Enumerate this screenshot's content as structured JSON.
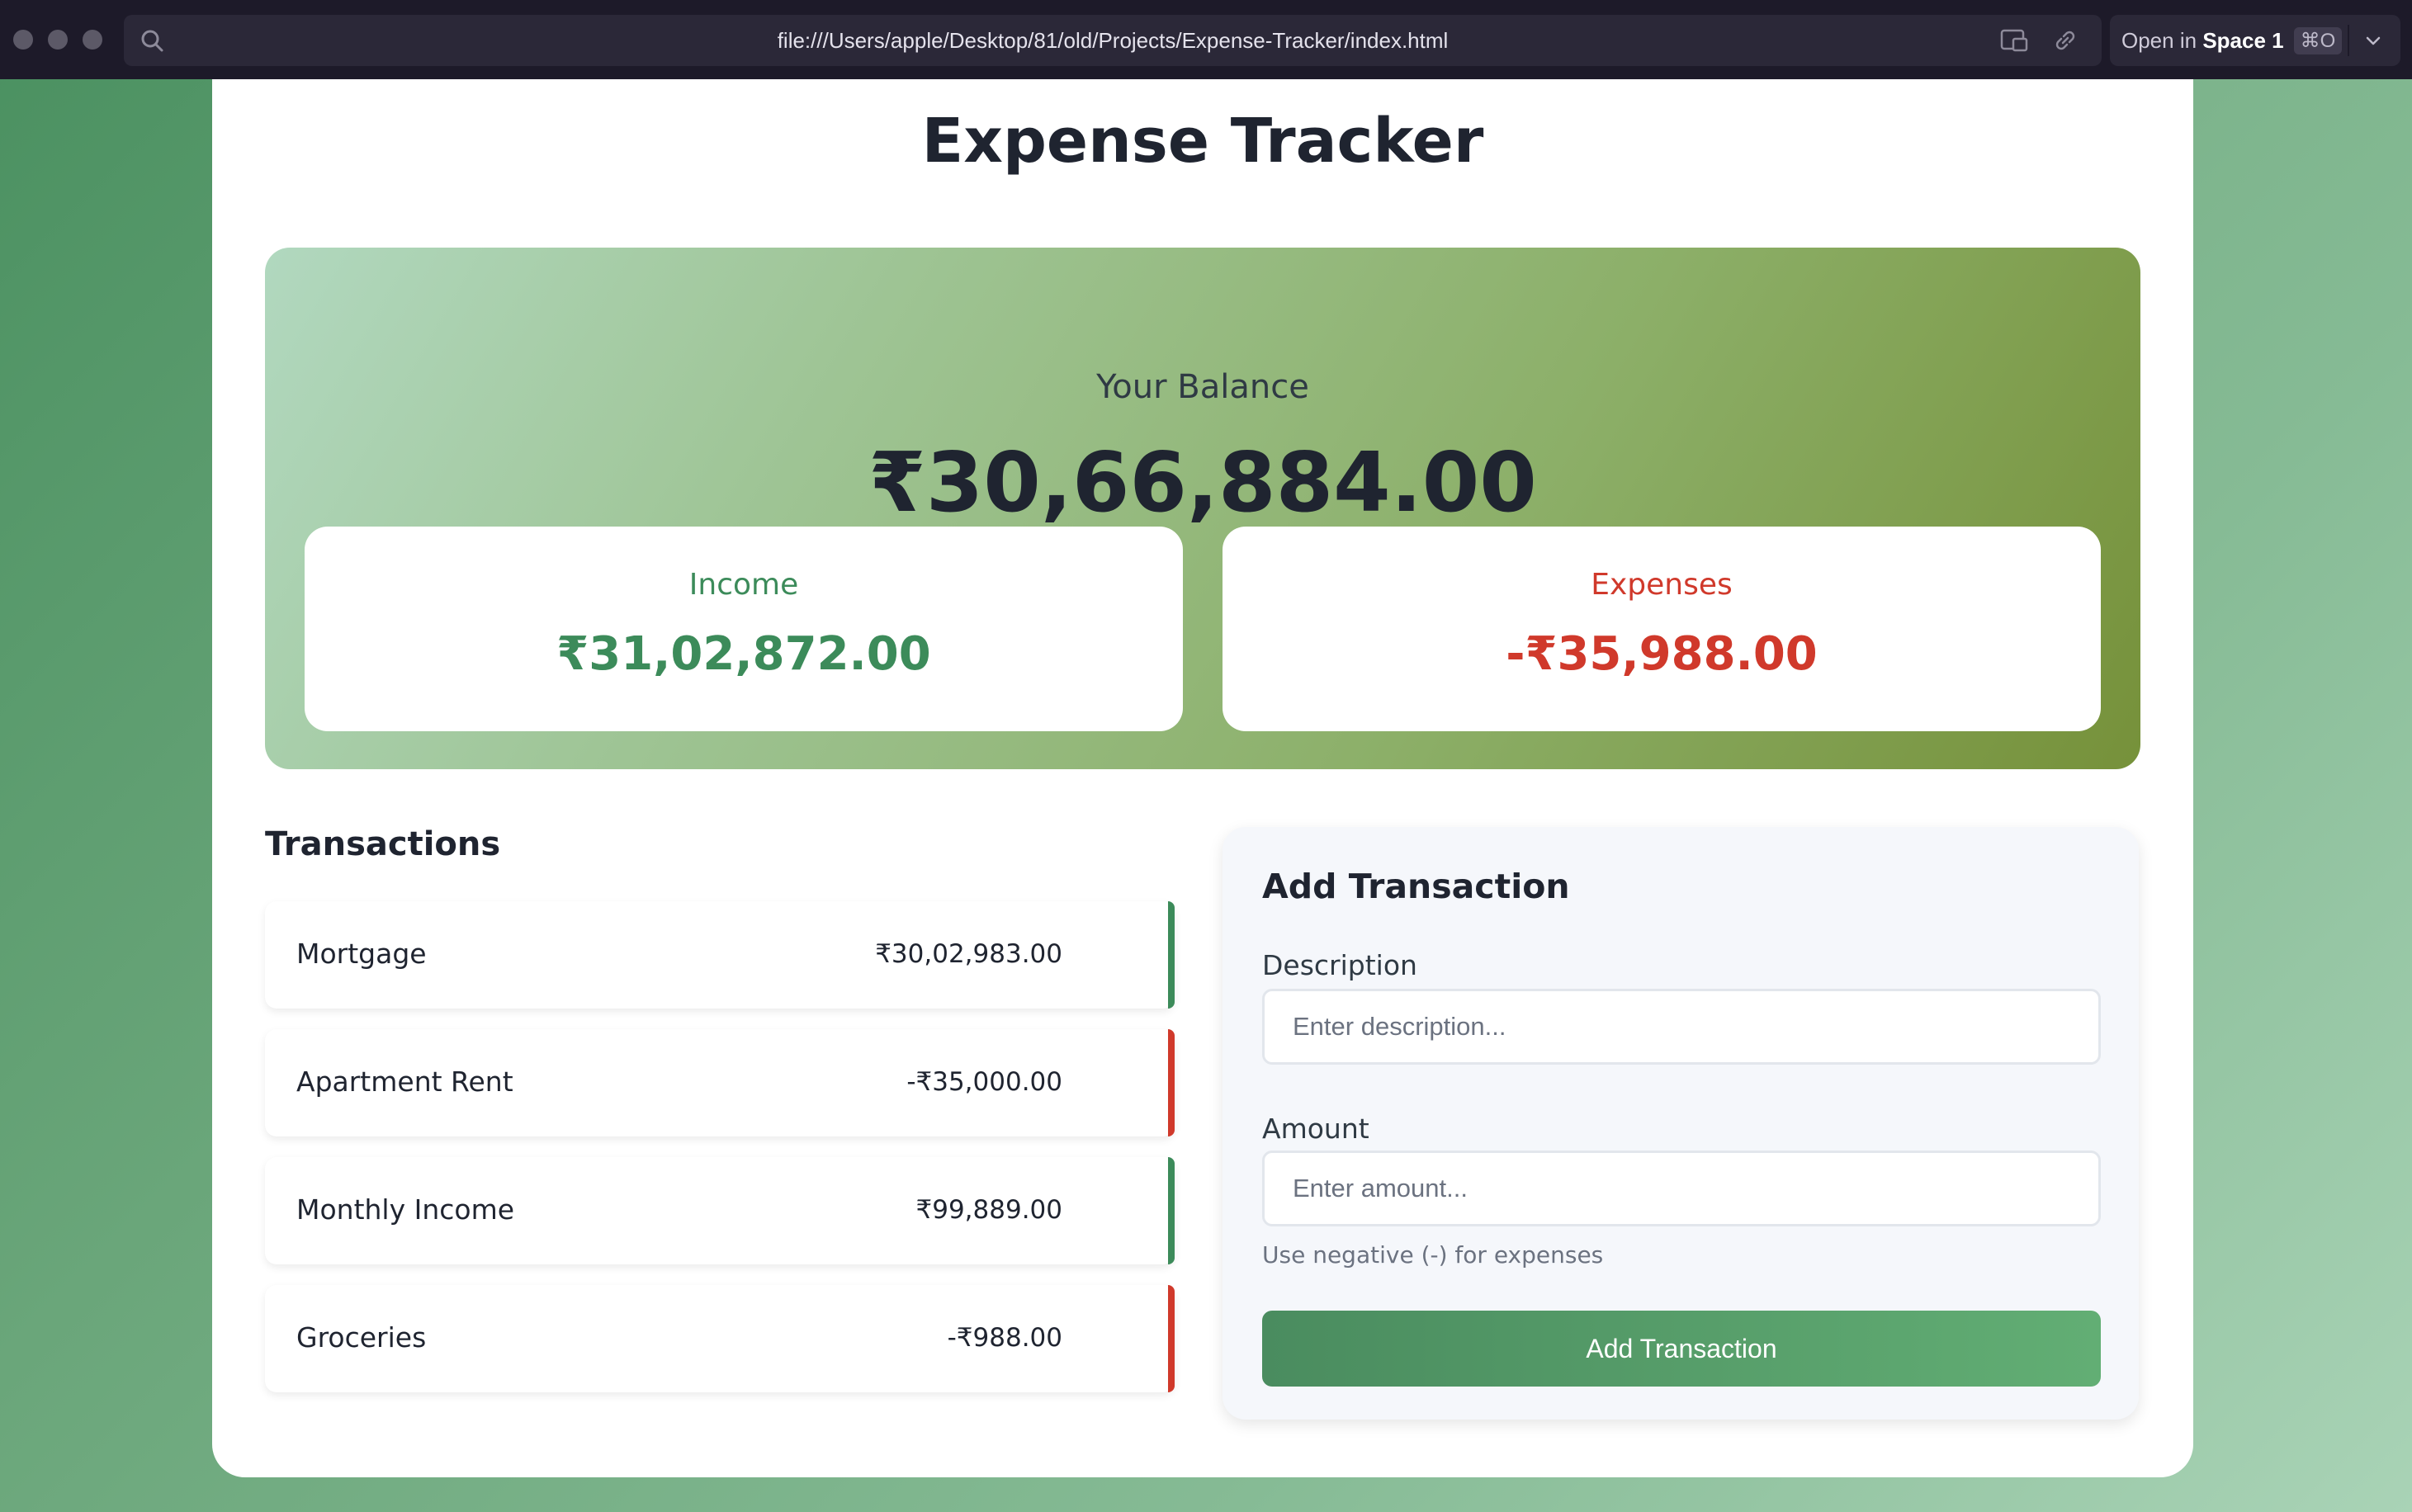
{
  "browser": {
    "url": "file:///Users/apple/Desktop/81/old/Projects/Expense-Tracker/index.html",
    "open_in_prefix": "Open in",
    "open_in_space": "Space 1",
    "open_in_shortcut": "⌘O"
  },
  "app": {
    "title": "Expense Tracker"
  },
  "balance": {
    "label": "Your Balance",
    "amount": "₹30,66,884.00",
    "income_label": "Income",
    "income_value": "₹31,02,872.00",
    "expenses_label": "Expenses",
    "expenses_value": "-₹35,988.00"
  },
  "transactions": {
    "heading": "Transactions",
    "items": [
      {
        "description": "Mortgage",
        "amount": "₹30,02,983.00",
        "type": "income"
      },
      {
        "description": "Apartment Rent",
        "amount": "-₹35,000.00",
        "type": "expense"
      },
      {
        "description": "Monthly Income",
        "amount": "₹99,889.00",
        "type": "income"
      },
      {
        "description": "Groceries",
        "amount": "-₹988.00",
        "type": "expense"
      }
    ]
  },
  "add_form": {
    "heading": "Add Transaction",
    "description_label": "Description",
    "description_placeholder": "Enter description...",
    "description_value": "",
    "amount_label": "Amount",
    "amount_placeholder": "Enter amount...",
    "amount_value": "",
    "hint": "Use negative (-) for expenses",
    "submit_label": "Add Transaction"
  },
  "colors": {
    "income": "#3c8b5a",
    "expense": "#d0392b",
    "text_dark": "#1f2430"
  }
}
